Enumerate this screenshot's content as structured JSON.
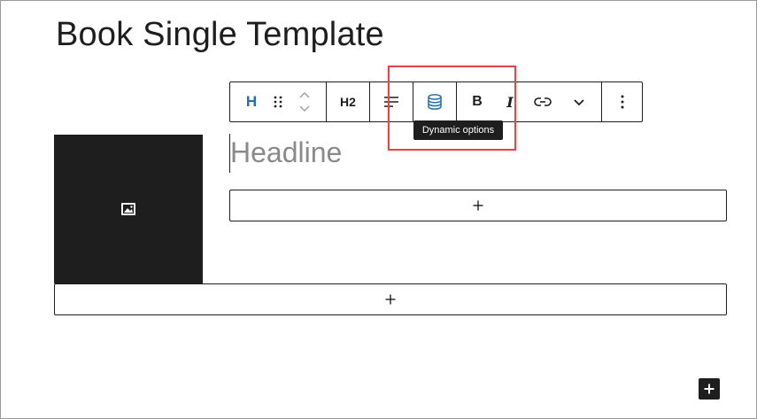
{
  "page": {
    "title": "Book Single Template"
  },
  "toolbar": {
    "block_type_letter": "H",
    "heading_level_label": "H2",
    "bold_label": "B",
    "italic_label": "I",
    "tooltip": "Dynamic options"
  },
  "icons": {
    "block_type": "heading-icon",
    "drag": "drag-handle-icon",
    "move": "move-up-down-icon",
    "align": "align-icon",
    "dynamic": "database-icon",
    "link": "link-icon",
    "more_rich_text": "chevron-down-icon",
    "options": "more-vertical-icon",
    "image": "image-placeholder-icon",
    "add": "plus-icon"
  },
  "editor": {
    "headline_placeholder": "Headline"
  },
  "colors": {
    "accent": "#2271b1",
    "dark": "#1e1e1e",
    "highlight": "#e0474c",
    "placeholder": "#8a8a8a"
  }
}
